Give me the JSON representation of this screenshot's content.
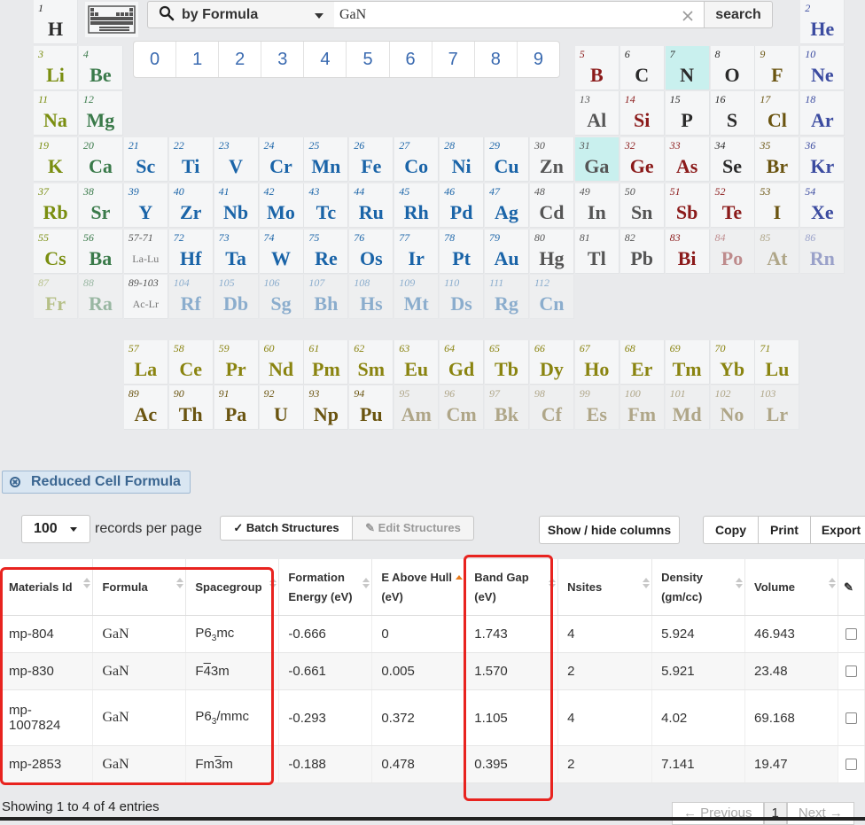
{
  "search": {
    "mode_label": "by Formula",
    "query": "GaN",
    "button_label": "search"
  },
  "digits": [
    "0",
    "1",
    "2",
    "3",
    "4",
    "5",
    "6",
    "7",
    "8",
    "9"
  ],
  "elements": [
    {
      "n": "1",
      "s": "H",
      "r": 0,
      "c": 0,
      "cat": "h"
    },
    {
      "n": "2",
      "s": "He",
      "r": 0,
      "c": 17,
      "cat": "noble"
    },
    {
      "n": "3",
      "s": "Li",
      "r": 1,
      "c": 0,
      "cat": "alkali"
    },
    {
      "n": "4",
      "s": "Be",
      "r": 1,
      "c": 1,
      "cat": "alkearth"
    },
    {
      "n": "5",
      "s": "B",
      "r": 1,
      "c": 12,
      "cat": "metalloid"
    },
    {
      "n": "6",
      "s": "C",
      "r": 1,
      "c": 13,
      "cat": "nonmetal"
    },
    {
      "n": "7",
      "s": "N",
      "r": 1,
      "c": 14,
      "cat": "nonmetal",
      "hl": true
    },
    {
      "n": "8",
      "s": "O",
      "r": 1,
      "c": 15,
      "cat": "nonmetal"
    },
    {
      "n": "9",
      "s": "F",
      "r": 1,
      "c": 16,
      "cat": "halogen"
    },
    {
      "n": "10",
      "s": "Ne",
      "r": 1,
      "c": 17,
      "cat": "noble"
    },
    {
      "n": "11",
      "s": "Na",
      "r": 2,
      "c": 0,
      "cat": "alkali"
    },
    {
      "n": "12",
      "s": "Mg",
      "r": 2,
      "c": 1,
      "cat": "alkearth"
    },
    {
      "n": "13",
      "s": "Al",
      "r": 2,
      "c": 12,
      "cat": "post"
    },
    {
      "n": "14",
      "s": "Si",
      "r": 2,
      "c": 13,
      "cat": "metalloid"
    },
    {
      "n": "15",
      "s": "P",
      "r": 2,
      "c": 14,
      "cat": "nonmetal"
    },
    {
      "n": "16",
      "s": "S",
      "r": 2,
      "c": 15,
      "cat": "nonmetal"
    },
    {
      "n": "17",
      "s": "Cl",
      "r": 2,
      "c": 16,
      "cat": "halogen"
    },
    {
      "n": "18",
      "s": "Ar",
      "r": 2,
      "c": 17,
      "cat": "noble"
    },
    {
      "n": "19",
      "s": "K",
      "r": 3,
      "c": 0,
      "cat": "alkali"
    },
    {
      "n": "20",
      "s": "Ca",
      "r": 3,
      "c": 1,
      "cat": "alkearth"
    },
    {
      "n": "21",
      "s": "Sc",
      "r": 3,
      "c": 2,
      "cat": "trans"
    },
    {
      "n": "22",
      "s": "Ti",
      "r": 3,
      "c": 3,
      "cat": "trans"
    },
    {
      "n": "23",
      "s": "V",
      "r": 3,
      "c": 4,
      "cat": "trans"
    },
    {
      "n": "24",
      "s": "Cr",
      "r": 3,
      "c": 5,
      "cat": "trans"
    },
    {
      "n": "25",
      "s": "Mn",
      "r": 3,
      "c": 6,
      "cat": "trans"
    },
    {
      "n": "26",
      "s": "Fe",
      "r": 3,
      "c": 7,
      "cat": "trans"
    },
    {
      "n": "27",
      "s": "Co",
      "r": 3,
      "c": 8,
      "cat": "trans"
    },
    {
      "n": "28",
      "s": "Ni",
      "r": 3,
      "c": 9,
      "cat": "trans"
    },
    {
      "n": "29",
      "s": "Cu",
      "r": 3,
      "c": 10,
      "cat": "trans"
    },
    {
      "n": "30",
      "s": "Zn",
      "r": 3,
      "c": 11,
      "cat": "post"
    },
    {
      "n": "31",
      "s": "Ga",
      "r": 3,
      "c": 12,
      "cat": "post",
      "hl": true
    },
    {
      "n": "32",
      "s": "Ge",
      "r": 3,
      "c": 13,
      "cat": "metalloid"
    },
    {
      "n": "33",
      "s": "As",
      "r": 3,
      "c": 14,
      "cat": "metalloid"
    },
    {
      "n": "34",
      "s": "Se",
      "r": 3,
      "c": 15,
      "cat": "nonmetal"
    },
    {
      "n": "35",
      "s": "Br",
      "r": 3,
      "c": 16,
      "cat": "halogen"
    },
    {
      "n": "36",
      "s": "Kr",
      "r": 3,
      "c": 17,
      "cat": "noble"
    },
    {
      "n": "37",
      "s": "Rb",
      "r": 4,
      "c": 0,
      "cat": "alkali"
    },
    {
      "n": "38",
      "s": "Sr",
      "r": 4,
      "c": 1,
      "cat": "alkearth"
    },
    {
      "n": "39",
      "s": "Y",
      "r": 4,
      "c": 2,
      "cat": "trans"
    },
    {
      "n": "40",
      "s": "Zr",
      "r": 4,
      "c": 3,
      "cat": "trans"
    },
    {
      "n": "41",
      "s": "Nb",
      "r": 4,
      "c": 4,
      "cat": "trans"
    },
    {
      "n": "42",
      "s": "Mo",
      "r": 4,
      "c": 5,
      "cat": "trans"
    },
    {
      "n": "43",
      "s": "Tc",
      "r": 4,
      "c": 6,
      "cat": "trans"
    },
    {
      "n": "44",
      "s": "Ru",
      "r": 4,
      "c": 7,
      "cat": "trans"
    },
    {
      "n": "45",
      "s": "Rh",
      "r": 4,
      "c": 8,
      "cat": "trans"
    },
    {
      "n": "46",
      "s": "Pd",
      "r": 4,
      "c": 9,
      "cat": "trans"
    },
    {
      "n": "47",
      "s": "Ag",
      "r": 4,
      "c": 10,
      "cat": "trans"
    },
    {
      "n": "48",
      "s": "Cd",
      "r": 4,
      "c": 11,
      "cat": "post"
    },
    {
      "n": "49",
      "s": "In",
      "r": 4,
      "c": 12,
      "cat": "post"
    },
    {
      "n": "50",
      "s": "Sn",
      "r": 4,
      "c": 13,
      "cat": "post"
    },
    {
      "n": "51",
      "s": "Sb",
      "r": 4,
      "c": 14,
      "cat": "metalloid"
    },
    {
      "n": "52",
      "s": "Te",
      "r": 4,
      "c": 15,
      "cat": "metalloid"
    },
    {
      "n": "53",
      "s": "I",
      "r": 4,
      "c": 16,
      "cat": "halogen"
    },
    {
      "n": "54",
      "s": "Xe",
      "r": 4,
      "c": 17,
      "cat": "noble"
    },
    {
      "n": "55",
      "s": "Cs",
      "r": 5,
      "c": 0,
      "cat": "alkali"
    },
    {
      "n": "56",
      "s": "Ba",
      "r": 5,
      "c": 1,
      "cat": "alkearth"
    },
    {
      "n": "57-71",
      "s": "La-Lu",
      "r": 5,
      "c": 2,
      "cat": "placeholder"
    },
    {
      "n": "72",
      "s": "Hf",
      "r": 5,
      "c": 3,
      "cat": "trans"
    },
    {
      "n": "73",
      "s": "Ta",
      "r": 5,
      "c": 4,
      "cat": "trans"
    },
    {
      "n": "74",
      "s": "W",
      "r": 5,
      "c": 5,
      "cat": "trans"
    },
    {
      "n": "75",
      "s": "Re",
      "r": 5,
      "c": 6,
      "cat": "trans"
    },
    {
      "n": "76",
      "s": "Os",
      "r": 5,
      "c": 7,
      "cat": "trans"
    },
    {
      "n": "77",
      "s": "Ir",
      "r": 5,
      "c": 8,
      "cat": "trans"
    },
    {
      "n": "78",
      "s": "Pt",
      "r": 5,
      "c": 9,
      "cat": "trans"
    },
    {
      "n": "79",
      "s": "Au",
      "r": 5,
      "c": 10,
      "cat": "trans"
    },
    {
      "n": "80",
      "s": "Hg",
      "r": 5,
      "c": 11,
      "cat": "post"
    },
    {
      "n": "81",
      "s": "Tl",
      "r": 5,
      "c": 12,
      "cat": "post"
    },
    {
      "n": "82",
      "s": "Pb",
      "r": 5,
      "c": 13,
      "cat": "post"
    },
    {
      "n": "83",
      "s": "Bi",
      "r": 5,
      "c": 14,
      "cat": "metalloid"
    },
    {
      "n": "84",
      "s": "Po",
      "r": 5,
      "c": 15,
      "cat": "metalloid",
      "faded": true
    },
    {
      "n": "85",
      "s": "At",
      "r": 5,
      "c": 16,
      "cat": "halogen",
      "faded": true
    },
    {
      "n": "86",
      "s": "Rn",
      "r": 5,
      "c": 17,
      "cat": "noble",
      "faded": true
    },
    {
      "n": "87",
      "s": "Fr",
      "r": 6,
      "c": 0,
      "cat": "alkali",
      "faded": true
    },
    {
      "n": "88",
      "s": "Ra",
      "r": 6,
      "c": 1,
      "cat": "alkearth",
      "faded": true
    },
    {
      "n": "89-103",
      "s": "Ac-Lr",
      "r": 6,
      "c": 2,
      "cat": "placeholder"
    },
    {
      "n": "104",
      "s": "Rf",
      "r": 6,
      "c": 3,
      "cat": "trans",
      "faded": true
    },
    {
      "n": "105",
      "s": "Db",
      "r": 6,
      "c": 4,
      "cat": "trans",
      "faded": true
    },
    {
      "n": "106",
      "s": "Sg",
      "r": 6,
      "c": 5,
      "cat": "trans",
      "faded": true
    },
    {
      "n": "107",
      "s": "Bh",
      "r": 6,
      "c": 6,
      "cat": "trans",
      "faded": true
    },
    {
      "n": "108",
      "s": "Hs",
      "r": 6,
      "c": 7,
      "cat": "trans",
      "faded": true
    },
    {
      "n": "109",
      "s": "Mt",
      "r": 6,
      "c": 8,
      "cat": "trans",
      "faded": true
    },
    {
      "n": "110",
      "s": "Ds",
      "r": 6,
      "c": 9,
      "cat": "trans",
      "faded": true
    },
    {
      "n": "111",
      "s": "Rg",
      "r": 6,
      "c": 10,
      "cat": "trans",
      "faded": true
    },
    {
      "n": "112",
      "s": "Cn",
      "r": 6,
      "c": 11,
      "cat": "trans",
      "faded": true
    },
    {
      "n": "57",
      "s": "La",
      "r": 7,
      "c": 2,
      "cat": "lanth"
    },
    {
      "n": "58",
      "s": "Ce",
      "r": 7,
      "c": 3,
      "cat": "lanth"
    },
    {
      "n": "59",
      "s": "Pr",
      "r": 7,
      "c": 4,
      "cat": "lanth"
    },
    {
      "n": "60",
      "s": "Nd",
      "r": 7,
      "c": 5,
      "cat": "lanth"
    },
    {
      "n": "61",
      "s": "Pm",
      "r": 7,
      "c": 6,
      "cat": "lanth"
    },
    {
      "n": "62",
      "s": "Sm",
      "r": 7,
      "c": 7,
      "cat": "lanth"
    },
    {
      "n": "63",
      "s": "Eu",
      "r": 7,
      "c": 8,
      "cat": "lanth"
    },
    {
      "n": "64",
      "s": "Gd",
      "r": 7,
      "c": 9,
      "cat": "lanth"
    },
    {
      "n": "65",
      "s": "Tb",
      "r": 7,
      "c": 10,
      "cat": "lanth"
    },
    {
      "n": "66",
      "s": "Dy",
      "r": 7,
      "c": 11,
      "cat": "lanth"
    },
    {
      "n": "67",
      "s": "Ho",
      "r": 7,
      "c": 12,
      "cat": "lanth"
    },
    {
      "n": "68",
      "s": "Er",
      "r": 7,
      "c": 13,
      "cat": "lanth"
    },
    {
      "n": "69",
      "s": "Tm",
      "r": 7,
      "c": 14,
      "cat": "lanth"
    },
    {
      "n": "70",
      "s": "Yb",
      "r": 7,
      "c": 15,
      "cat": "lanth"
    },
    {
      "n": "71",
      "s": "Lu",
      "r": 7,
      "c": 16,
      "cat": "lanth"
    },
    {
      "n": "89",
      "s": "Ac",
      "r": 8,
      "c": 2,
      "cat": "act"
    },
    {
      "n": "90",
      "s": "Th",
      "r": 8,
      "c": 3,
      "cat": "act"
    },
    {
      "n": "91",
      "s": "Pa",
      "r": 8,
      "c": 4,
      "cat": "act"
    },
    {
      "n": "92",
      "s": "U",
      "r": 8,
      "c": 5,
      "cat": "act"
    },
    {
      "n": "93",
      "s": "Np",
      "r": 8,
      "c": 6,
      "cat": "act"
    },
    {
      "n": "94",
      "s": "Pu",
      "r": 8,
      "c": 7,
      "cat": "act"
    },
    {
      "n": "95",
      "s": "Am",
      "r": 8,
      "c": 8,
      "cat": "act",
      "faded": true
    },
    {
      "n": "96",
      "s": "Cm",
      "r": 8,
      "c": 9,
      "cat": "act",
      "faded": true
    },
    {
      "n": "97",
      "s": "Bk",
      "r": 8,
      "c": 10,
      "cat": "act",
      "faded": true
    },
    {
      "n": "98",
      "s": "Cf",
      "r": 8,
      "c": 11,
      "cat": "act",
      "faded": true
    },
    {
      "n": "99",
      "s": "Es",
      "r": 8,
      "c": 12,
      "cat": "act",
      "faded": true
    },
    {
      "n": "100",
      "s": "Fm",
      "r": 8,
      "c": 13,
      "cat": "act",
      "faded": true
    },
    {
      "n": "101",
      "s": "Md",
      "r": 8,
      "c": 14,
      "cat": "act",
      "faded": true
    },
    {
      "n": "102",
      "s": "No",
      "r": 8,
      "c": 15,
      "cat": "act",
      "faded": true
    },
    {
      "n": "103",
      "s": "Lr",
      "r": 8,
      "c": 16,
      "cat": "act",
      "faded": true
    }
  ],
  "filter": {
    "label": "Reduced Cell Formula"
  },
  "toolbar": {
    "records_value": "100",
    "records_label": "records per page",
    "batch_label": "Batch Structures",
    "edit_label": "Edit Structures",
    "showhide_label": "Show / hide columns",
    "copy_label": "Copy",
    "print_label": "Print",
    "export_label": "Export"
  },
  "table": {
    "headers": {
      "id": "Materials Id",
      "formula": "Formula",
      "spacegroup": "Spacegroup",
      "formation1": "Formation",
      "formation2": "Energy (eV)",
      "hull1": "E Above Hull",
      "hull2": "(eV)",
      "gap1": "Band Gap",
      "gap2": "(eV)",
      "nsites": "Nsites",
      "density1": "Density",
      "density2": "(gm/cc)",
      "volume": "Volume"
    },
    "rows": [
      {
        "id1": "mp-804",
        "id2": "",
        "formula": "GaN",
        "sg_a": "P6",
        "sg_sub": "3",
        "sg_b": "mc",
        "formation": "-0.666",
        "hull": "0",
        "gap": "1.743",
        "nsites": "4",
        "density": "5.924",
        "volume": "46.943"
      },
      {
        "id1": "mp-830",
        "id2": "",
        "formula": "GaN",
        "sg_a": "F",
        "sg_over": "4",
        "sg_b": "3m",
        "formation": "-0.661",
        "hull": "0.005",
        "gap": "1.570",
        "nsites": "2",
        "density": "5.921",
        "volume": "23.48"
      },
      {
        "id1": "mp-",
        "id2": "1007824",
        "formula": "GaN",
        "sg_a": "P6",
        "sg_sub": "3",
        "sg_b": "/mmc",
        "formation": "-0.293",
        "hull": "0.372",
        "gap": "1.105",
        "nsites": "4",
        "density": "4.02",
        "volume": "69.168"
      },
      {
        "id1": "mp-2853",
        "id2": "",
        "formula": "GaN",
        "sg_a": "Fm",
        "sg_over": "3",
        "sg_b": "m",
        "formation": "-0.188",
        "hull": "0.478",
        "gap": "0.395",
        "nsites": "2",
        "density": "7.141",
        "volume": "19.47"
      }
    ]
  },
  "footer": {
    "showing": "Showing 1 to 4 of 4 entries",
    "prev": "← Previous",
    "page": "1",
    "next": "Next →"
  },
  "colors": {
    "highlight_box": "#e8231f",
    "selected_element": "#c9f0ee",
    "accent": "#3a6590"
  }
}
